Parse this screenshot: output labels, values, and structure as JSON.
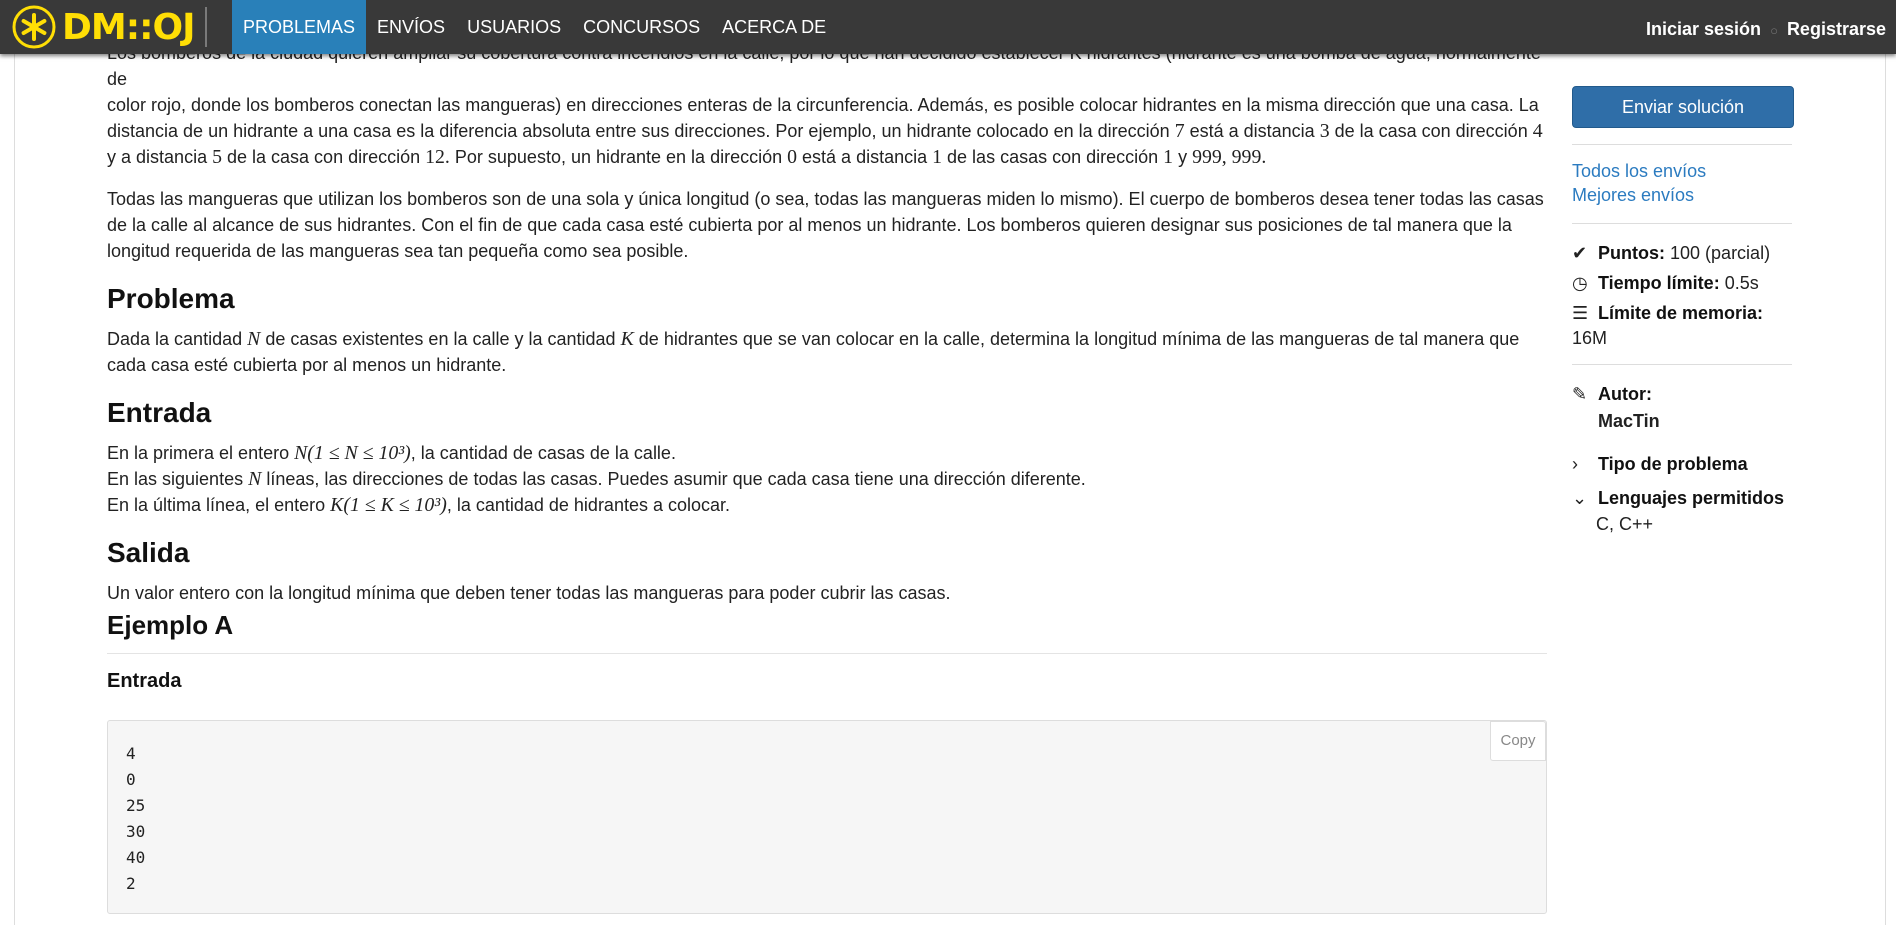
{
  "nav": {
    "logo_text": "DM::OJ",
    "items": [
      "PROBLEMAS",
      "ENVÍOS",
      "USUARIOS",
      "CONCURSOS",
      "ACERCA DE"
    ],
    "login": "Iniciar sesión",
    "sep": "○",
    "register": "Registrarse"
  },
  "content": {
    "intro_line1_cut": "Los bomberos de la ciudad quieren ampliar su cobertura contra incendios en la calle, por lo que han decidido establecer K hidrantes (hidrante es una bomba de agua, normalmente de",
    "intro_rest_a": "color rojo, donde los bomberos conectan las mangueras) en direcciones enteras de la circunferencia. Además, es posible colocar hidrantes en la misma dirección que una casa. La",
    "intro_rest_b": "distancia de un hidrante a una casa es la diferencia absoluta entre sus direcciones. Por ejemplo, un hidrante colocado en la dirección",
    "intro_n7": "7",
    "intro_rest_c": "está a distancia",
    "intro_n3": "3",
    "intro_rest_d": "de la casa con dirección",
    "intro_n4": "4",
    "intro_rest_e": "y a",
    "intro_rest_f": "distancia",
    "intro_n5": "5",
    "intro_rest_g": "de la casa con dirección",
    "intro_n12": "12.",
    "intro_rest_h": "Por supuesto, un hidrante en la dirección",
    "intro_n0": "0",
    "intro_rest_i": "está a distancia",
    "intro_n1": "1",
    "intro_rest_j": "de las casas con dirección",
    "intro_n1b": "1",
    "intro_rest_k": "y",
    "intro_n999": "999, 999.",
    "para2": "Todas las mangueras que utilizan los bomberos son de una sola y única longitud (o sea, todas las mangueras miden lo mismo). El cuerpo de bomberos desea tener todas las casas de la calle al alcance de sus hidrantes. Con el fin de que cada casa esté cubierta por al menos un hidrante. Los bomberos quieren designar sus posiciones de tal manera que la longitud requerida de las mangueras sea tan pequeña como sea posible.",
    "h_problema": "Problema",
    "problema_a": "Dada la cantidad",
    "var_n": "N",
    "problema_b": "de casas existentes en la calle y la cantidad",
    "var_k": "K",
    "problema_c": "de hidrantes que se van colocar en la calle, determina la longitud mínima de las mangueras de tal manera que cada casa esté cubierta por al menos un hidrante.",
    "h_entrada": "Entrada",
    "entrada_1a": "En la primera el entero",
    "entrada_1m": "N(1 ≤ N ≤ 10³)",
    "entrada_1b": ", la cantidad de casas de la calle.",
    "entrada_2a": "En las siguientes",
    "entrada_2m": "N",
    "entrada_2b": "líneas, las direcciones de todas las casas. Puedes asumir que cada casa tiene una dirección diferente.",
    "entrada_3a": "En la última línea, el entero",
    "entrada_3m": "K(1 ≤ K ≤ 10³)",
    "entrada_3b": ", la cantidad de hidrantes a colocar.",
    "h_salida": "Salida",
    "salida": "Un valor entero con la longitud mínima que deben tener todas las mangueras para poder cubrir las casas.",
    "ejemplo_title": "Ejemplo A",
    "entrada_label": "Entrada",
    "sample_input": "4\n0\n25\n30\n40\n2",
    "copy": "Copy"
  },
  "sidebar": {
    "submit": "Enviar solución",
    "all_submissions": "Todos los envíos",
    "best_submissions": "Mejores envíos",
    "points_label": "Puntos:",
    "points_value": "100 (parcial)",
    "time_label": "Tiempo límite:",
    "time_value": "0.5s",
    "memory_label": "Límite de memoria:",
    "memory_value": "16M",
    "author_label": "Autor:",
    "author_name": "MacTin",
    "type_label": "Tipo de problema",
    "langs_label": "Lenguajes permitidos",
    "langs_value": "C, C++"
  }
}
